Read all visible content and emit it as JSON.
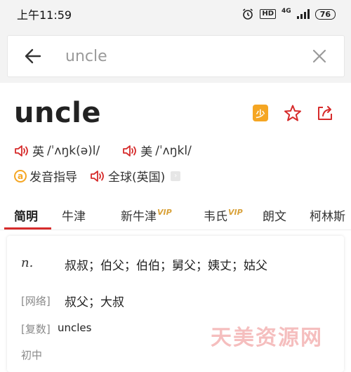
{
  "status": {
    "time": "上午11:59",
    "hd": "HD",
    "network": "4G",
    "battery": "76"
  },
  "search": {
    "query": "uncle"
  },
  "entry": {
    "word": "uncle",
    "pinyin_badge": "少",
    "uk": {
      "label": "英",
      "ipa": "/ˈʌŋk(ə)l/"
    },
    "us": {
      "label": "美",
      "ipa": "/ˈʌŋkl/"
    },
    "guide": "发音指导",
    "global": "全球(英国)"
  },
  "tabs": [
    {
      "label": "简明",
      "vip": ""
    },
    {
      "label": "牛津",
      "vip": ""
    },
    {
      "label": "新牛津",
      "vip": "VIP"
    },
    {
      "label": "韦氏",
      "vip": "VIP"
    },
    {
      "label": "朗文",
      "vip": ""
    },
    {
      "label": "柯林斯",
      "vip": ""
    }
  ],
  "definition": {
    "pos": "n.",
    "meaning": "叔叔；伯父；伯伯；舅父；姨丈；姑父",
    "web_tag": "[网络]",
    "web_meaning": "叔父；大叔",
    "plural_tag": "[复数]",
    "plural": "uncles",
    "level": "初中"
  },
  "watermark": "天美资源网",
  "colors": {
    "accent": "#d62b2b",
    "vip": "#d9a23a",
    "badge": "#f5a623"
  }
}
